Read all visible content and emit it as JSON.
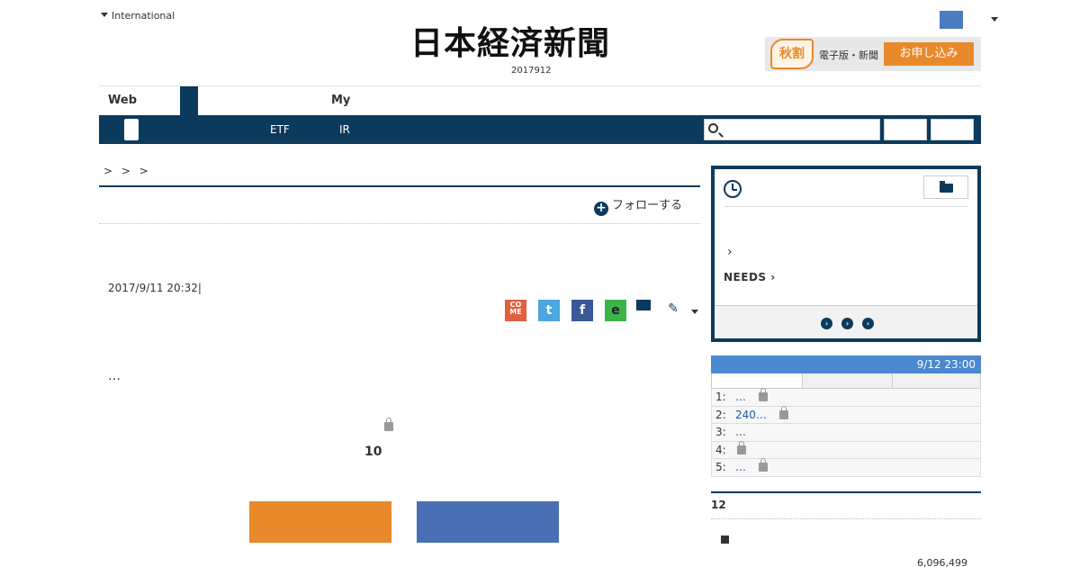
{
  "header": {
    "edition_label": "International",
    "logo_text": "日本経済新聞",
    "date": "2017912",
    "flag_color": "#4a7cbf",
    "promo": {
      "badge": "秋割",
      "text": "電子版・新聞",
      "button": "お申し込み"
    }
  },
  "tabs": {
    "web": "Web",
    "my": "My"
  },
  "nav": {
    "etf": "ETF",
    "ir": "IR",
    "search_placeholder": ""
  },
  "article": {
    "breadcrumb": "> > >",
    "follow_label": "フォローする",
    "timestamp": "2017/9/11 20:32|",
    "share_come": "CO ME",
    "ellipsis": "…",
    "count": "10"
  },
  "panel": {
    "chevron": "›",
    "needs_label": "NEEDS ›",
    "nav_dots": [
      "›",
      "›",
      "›"
    ]
  },
  "ranking": {
    "updated": "9/12 23:00",
    "rows": [
      {
        "rank": "1:",
        "text": "…",
        "locked": true
      },
      {
        "rank": "2:",
        "text": "240…",
        "locked": true
      },
      {
        "rank": "3:",
        "text": "…",
        "locked": false
      },
      {
        "rank": "4:",
        "text": "",
        "locked": true
      },
      {
        "rank": "5:",
        "text": "…",
        "locked": true
      }
    ]
  },
  "section": {
    "title": "12",
    "value": "6,096,499"
  },
  "colors": {
    "navy": "#0b3a5c",
    "orange": "#e8892c",
    "blue": "#4a6fb5",
    "rank_blue": "#4a88d0"
  }
}
